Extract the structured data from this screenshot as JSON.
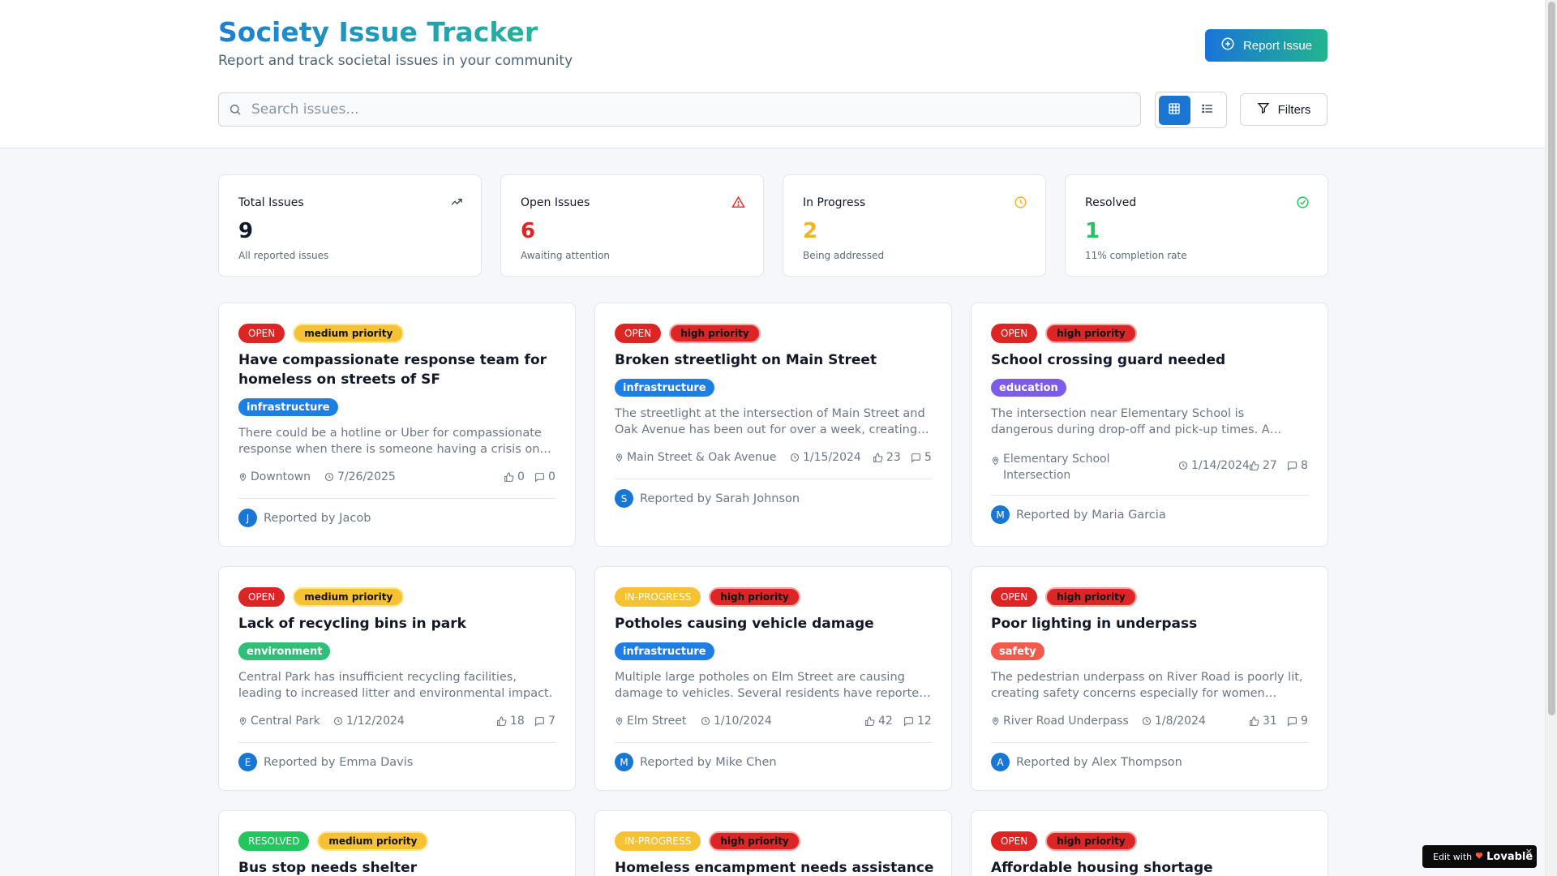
{
  "header": {
    "title": "Society Issue Tracker",
    "subtitle": "Report and track societal issues in your community",
    "report_button": "Report Issue",
    "search_placeholder": "Search issues...",
    "filters_button": "Filters"
  },
  "stats": [
    {
      "label": "Total Issues",
      "value": "9",
      "desc": "All reported issues",
      "color": "#111827"
    },
    {
      "label": "Open Issues",
      "value": "6",
      "desc": "Awaiting attention",
      "color": "#dc2626"
    },
    {
      "label": "In Progress",
      "value": "2",
      "desc": "Being addressed",
      "color": "#f0b323"
    },
    {
      "label": "Resolved",
      "value": "1",
      "desc": "11% completion rate",
      "color": "#22c55e"
    }
  ],
  "issues": [
    {
      "status": "OPEN",
      "priority": "medium priority",
      "title": "Have compassionate response team for homeless on streets of SF",
      "category": "infrastructure",
      "description": "There could be a hotline or Uber for compassionate response when there is someone having a crisis on the streets.",
      "location": "Downtown",
      "date": "7/26/2025",
      "likes": "0",
      "comments": "0",
      "reporter": "Reported by Jacob",
      "initial": "J"
    },
    {
      "status": "OPEN",
      "priority": "high priority",
      "title": "Broken streetlight on Main Street",
      "category": "infrastructure",
      "description": "The streetlight at the intersection of Main Street and Oak Avenue has been out for over a week, creating safety concerns.",
      "location": "Main Street & Oak Avenue",
      "date": "1/15/2024",
      "likes": "23",
      "comments": "5",
      "reporter": "Reported by Sarah Johnson",
      "initial": "S"
    },
    {
      "status": "OPEN",
      "priority": "high priority",
      "title": "School crossing guard needed",
      "category": "education",
      "description": "The intersection near Elementary School is dangerous during drop-off and pick-up times. A crossing guard is needed.",
      "location": "Elementary School Intersection",
      "date": "1/14/2024",
      "likes": "27",
      "comments": "8",
      "reporter": "Reported by Maria Garcia",
      "initial": "M"
    },
    {
      "status": "OPEN",
      "priority": "medium priority",
      "title": "Lack of recycling bins in park",
      "category": "environment",
      "description": "Central Park has insufficient recycling facilities, leading to increased litter and environmental impact.",
      "location": "Central Park",
      "date": "1/12/2024",
      "likes": "18",
      "comments": "7",
      "reporter": "Reported by Emma Davis",
      "initial": "E"
    },
    {
      "status": "IN-PROGRESS",
      "priority": "high priority",
      "title": "Potholes causing vehicle damage",
      "category": "infrastructure",
      "description": "Multiple large potholes on Elm Street are causing damage to vehicles. Several residents have reported issues.",
      "location": "Elm Street",
      "date": "1/10/2024",
      "likes": "42",
      "comments": "12",
      "reporter": "Reported by Mike Chen",
      "initial": "M"
    },
    {
      "status": "OPEN",
      "priority": "high priority",
      "title": "Poor lighting in underpass",
      "category": "safety",
      "description": "The pedestrian underpass on River Road is poorly lit, creating safety concerns especially for women walking alone at night.",
      "location": "River Road Underpass",
      "date": "1/8/2024",
      "likes": "31",
      "comments": "9",
      "reporter": "Reported by Alex Thompson",
      "initial": "A"
    },
    {
      "status": "RESOLVED",
      "priority": "medium priority",
      "title": "Bus stop needs shelter"
    },
    {
      "status": "IN-PROGRESS",
      "priority": "high priority",
      "title": "Homeless encampment needs assistance"
    },
    {
      "status": "OPEN",
      "priority": "high priority",
      "title": "Affordable housing shortage"
    }
  ],
  "badge": {
    "edit_with": "Edit with",
    "brand": "Lovable",
    "close": "×"
  }
}
